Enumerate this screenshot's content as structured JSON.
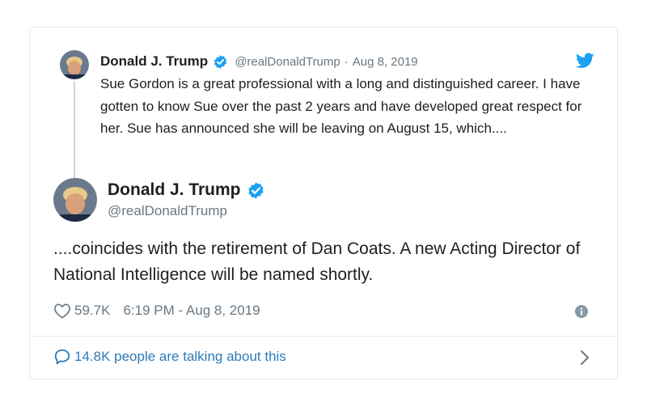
{
  "thread_tweet": {
    "name": "Donald J. Trump",
    "handle": "@realDonaldTrump",
    "separator": "·",
    "date": "Aug 8, 2019",
    "text": "Sue Gordon is a great professional with a long and distinguished career. I have gotten to know Sue over the past 2 years and have developed great respect for her. Sue has announced she will be leaving on August 15, which...."
  },
  "main_tweet": {
    "name": "Donald J. Trump",
    "handle": "@realDonaldTrump",
    "text": "....coincides with the retirement of Dan Coats. A new Acting Director of National Intelligence will be named shortly.",
    "likes": "59.7K",
    "timestamp": "6:19 PM - Aug 8, 2019"
  },
  "footer": {
    "talking_label": "14.8K people are talking about this"
  },
  "icons": {
    "verified": "verified-badge-icon",
    "twitter": "twitter-bird-icon",
    "like": "heart-icon",
    "info": "info-icon",
    "conversation": "speech-bubble-icon",
    "chevron": "chevron-right-icon"
  },
  "colors": {
    "twitter_blue": "#1da1f2",
    "link_blue": "#2b7bb9",
    "secondary_text": "#697882",
    "primary_text": "#1c2022",
    "border": "#e1e8ed"
  }
}
